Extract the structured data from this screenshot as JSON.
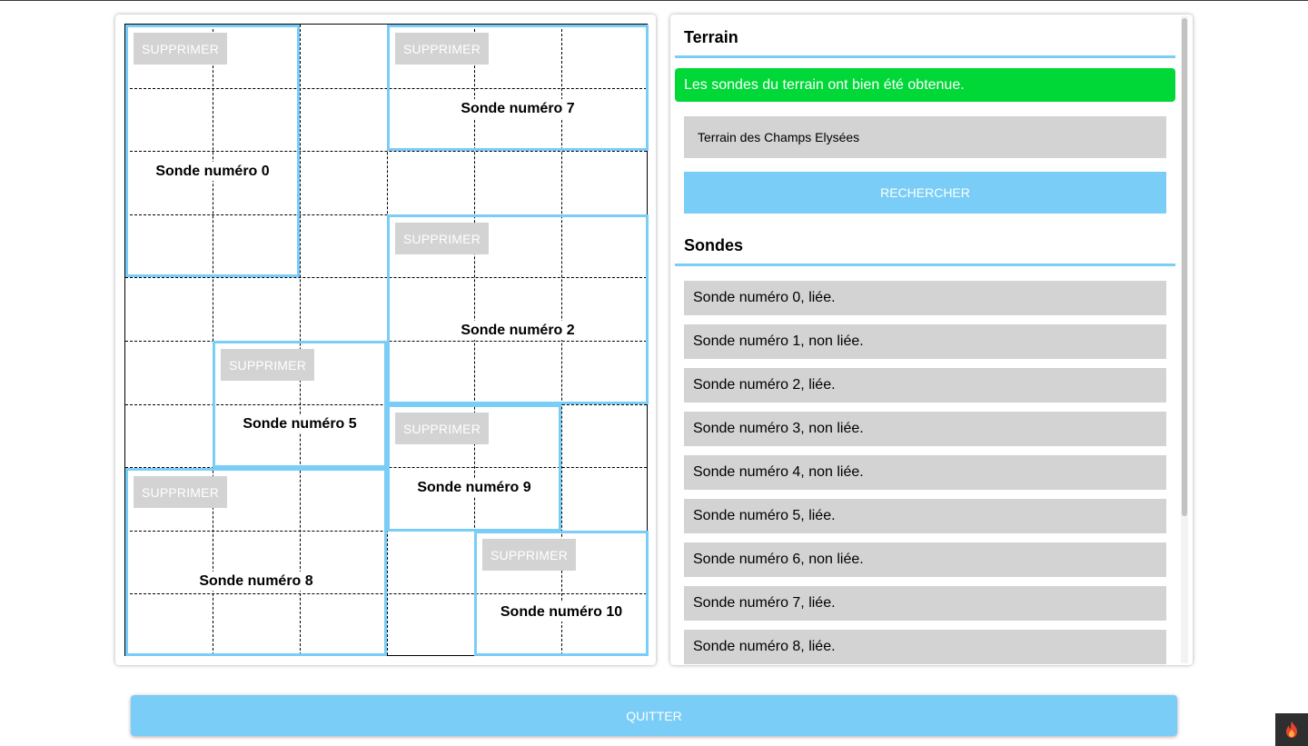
{
  "grid": {
    "columns": 6,
    "rows": 10,
    "probes": [
      {
        "delete_label": "SUPPRIMER",
        "label": "Sonde numéro 0"
      },
      {
        "delete_label": "SUPPRIMER",
        "label": "Sonde numéro 7"
      },
      {
        "delete_label": "SUPPRIMER",
        "label": "Sonde numéro 2"
      },
      {
        "delete_label": "SUPPRIMER",
        "label": "Sonde numéro 5"
      },
      {
        "delete_label": "SUPPRIMER",
        "label": "Sonde numéro 9"
      },
      {
        "delete_label": "SUPPRIMER",
        "label": "Sonde numéro 8"
      },
      {
        "delete_label": "SUPPRIMER",
        "label": "Sonde numéro 10"
      }
    ]
  },
  "sidebar": {
    "terrain_title": "Terrain",
    "success_message": "Les sondes du terrain ont bien été obtenue.",
    "terrain_input_value": "Terrain des Champs Elysées",
    "search_label": "RECHERCHER",
    "probes_title": "Sondes",
    "probe_items": [
      "Sonde numéro 0, liée.",
      "Sonde numéro 1, non liée.",
      "Sonde numéro 2, liée.",
      "Sonde numéro 3, non liée.",
      "Sonde numéro 4, non liée.",
      "Sonde numéro 5, liée.",
      "Sonde numéro 6, non liée.",
      "Sonde numéro 7, liée.",
      "Sonde numéro 8, liée."
    ]
  },
  "footer": {
    "quit_label": "QUITTER"
  },
  "colors": {
    "accent": "#7acdf7",
    "success": "#00d838",
    "neutral": "#d3d3d3"
  },
  "icons": {
    "corner_badge": "flame-icon"
  }
}
